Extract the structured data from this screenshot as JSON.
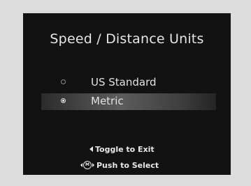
{
  "screen": {
    "title": "Speed / Distance Units"
  },
  "options": [
    {
      "label": "US Standard",
      "selected": false
    },
    {
      "label": "Metric",
      "selected": true
    }
  ],
  "hints": {
    "exit_label": "Toggle to Exit",
    "exit_icon": "left-arrow-icon",
    "select_label": "Push to Select",
    "select_icon": "interface-dial-icon",
    "select_icon_text": "M"
  },
  "colors": {
    "screen_background": "#121212",
    "text": "#e6e6e6",
    "highlight": "#5c5c5c",
    "frame": "#dcdcdc"
  }
}
